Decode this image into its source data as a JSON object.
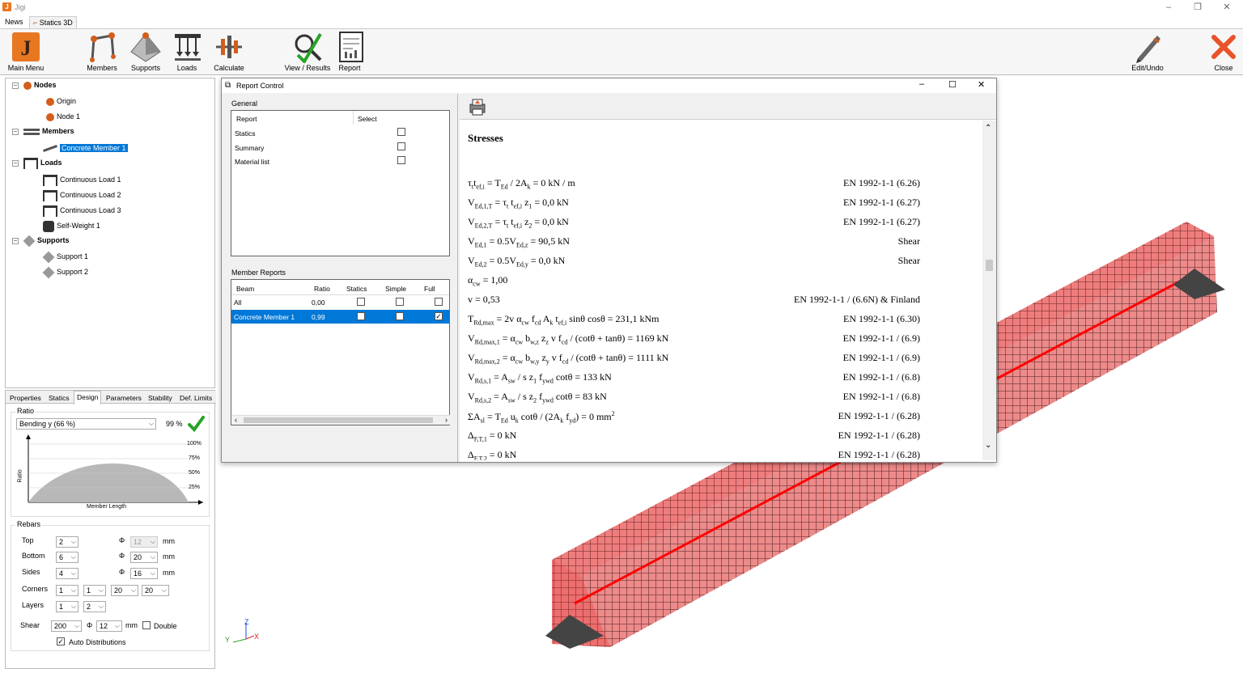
{
  "app": {
    "title": "Jigi",
    "logo_letter": "J"
  },
  "tabs": [
    {
      "label": "News"
    },
    {
      "label": "Statics 3D"
    }
  ],
  "ribbon": {
    "main_menu": "Main Menu",
    "members": "Members",
    "supports": "Supports",
    "loads": "Loads",
    "calculate": "Calculate",
    "view_results": "View / Results",
    "report": "Report",
    "edit_undo": "Edit/Undo",
    "close": "Close"
  },
  "tree": {
    "nodes": "Nodes",
    "origin": "Origin",
    "node1": "Node 1",
    "members": "Members",
    "concrete_member": "Concrete Member 1",
    "loads": "Loads",
    "load1": "Continuous Load 1",
    "load2": "Continuous Load 2",
    "load3": "Continuous Load 3",
    "selfweight": "Self-Weight 1",
    "supports": "Supports",
    "support1": "Support 1",
    "support2": "Support 2"
  },
  "prop_tabs": [
    "Properties",
    "Statics",
    "Design",
    "Parameters",
    "Stability",
    "Def. Limits"
  ],
  "design": {
    "ratio_label": "Ratio",
    "ratio_select": "Bending y (66 %)",
    "ratio_value": "99 %",
    "chart_ylabel": "Ratio",
    "chart_xlabel": "Member Length",
    "chart_ticks": [
      "100%",
      "75%",
      "50%",
      "25%"
    ],
    "rebars_label": "Rebars",
    "top_label": "Top",
    "top_count": "2",
    "top_dia": "12",
    "bottom_label": "Bottom",
    "bottom_count": "6",
    "bottom_dia": "20",
    "sides_label": "Sides",
    "sides_count": "4",
    "sides_dia": "16",
    "corners_label": "Corners",
    "corners": [
      "1",
      "1",
      "20",
      "20"
    ],
    "layers_label": "Layers",
    "layers": [
      "1",
      "2"
    ],
    "shear_label": "Shear",
    "shear_spacing": "200",
    "shear_dia": "12",
    "double_label": "Double",
    "auto_label": "Auto Distributions",
    "mm": "mm",
    "phi": "Φ"
  },
  "dialog": {
    "title": "Report Control",
    "general_label": "General",
    "general_headers": [
      "Report",
      "Select"
    ],
    "general_rows": [
      "Statics",
      "Summary",
      "Material list"
    ],
    "member_reports_label": "Member Reports",
    "mr_headers": [
      "Beam",
      "Ratio",
      "Statics",
      "Simple",
      "Full"
    ],
    "mr_rows": [
      {
        "beam": "All",
        "ratio": "0,00"
      },
      {
        "beam": "Concrete Member 1",
        "ratio": "0,99"
      }
    ],
    "report_heading": "Stresses",
    "equations": [
      {
        "lhs": "τ",
        "lhs_sub": "t",
        "mid": "t",
        "mid_sub": "ef,i",
        "rhs": " = T",
        "rhs_sub": "Ed",
        "tail": " / 2A",
        "tail_sub": "k",
        "end": " = 0 kN / m",
        "ref": "EN 1992-1-1 (6.26)"
      },
      {
        "text": "V_Ed,1,T = τ_t t_ef,i z_1 = 0,0 kN",
        "ref": "EN 1992-1-1 (6.27)"
      },
      {
        "text": "V_Ed,2,T = τ_t t_ef,i z_2 = 0,0 kN",
        "ref": "EN 1992-1-1 (6.27)"
      },
      {
        "text": "V_Ed,1 = 0.5V_Ed,z = 90,5 kN",
        "ref": "Shear"
      },
      {
        "text": "V_Ed,2 = 0.5V_Ed,y = 0,0 kN",
        "ref": "Shear"
      },
      {
        "text": "α_cw = 1,00",
        "ref": ""
      },
      {
        "text": "v = 0,53",
        "ref": "EN 1992-1-1 / (6.6N) & Finland"
      },
      {
        "text": "T_Rd,max = 2v α_cw f_cd A_k t_ef,i sinθ cosθ = 231,1 kNm",
        "ref": "EN 1992-1-1 (6.30)"
      },
      {
        "text": "V_Rd,max,1 = α_cw b_w,z z_z v f_cd / (cotθ + tanθ) = 1169 kN",
        "ref": "EN 1992-1-1 / (6.9)"
      },
      {
        "text": "V_Rd,max,2 = α_cw b_w,y z_y v f_cd / (cotθ + tanθ) = 1111 kN",
        "ref": "EN 1992-1-1 / (6.9)"
      },
      {
        "text": "V_Rd,s,1 = A_sw / s z_1 f_ywd cotθ = 133 kN",
        "ref": "EN 1992-1-1 / (6.8)"
      },
      {
        "text": "V_Rd,s,2 = A_sw / s z_2 f_ywd cotθ = 83 kN",
        "ref": "EN 1992-1-1 / (6.8)"
      },
      {
        "text": "ΣA_sl = T_Ed u_k cotθ / (2A_k f_yd) = 0 mm^2",
        "ref": "EN 1992-1-1 / (6.28)"
      },
      {
        "text": "Δ_F,T,1 = 0 kN",
        "ref": "EN 1992-1-1 / (6.28)"
      },
      {
        "text": "Δ_F,T,2 = 0 kN",
        "ref": "EN 1992-1-1 / (6.28)"
      }
    ]
  },
  "axes": {
    "z": "Z",
    "y": "Y",
    "x": "X"
  },
  "colors": {
    "accent": "#0078d7",
    "brand": "#e87722",
    "check": "#27a327",
    "close": "#e8542a",
    "beam": "#e02020"
  }
}
